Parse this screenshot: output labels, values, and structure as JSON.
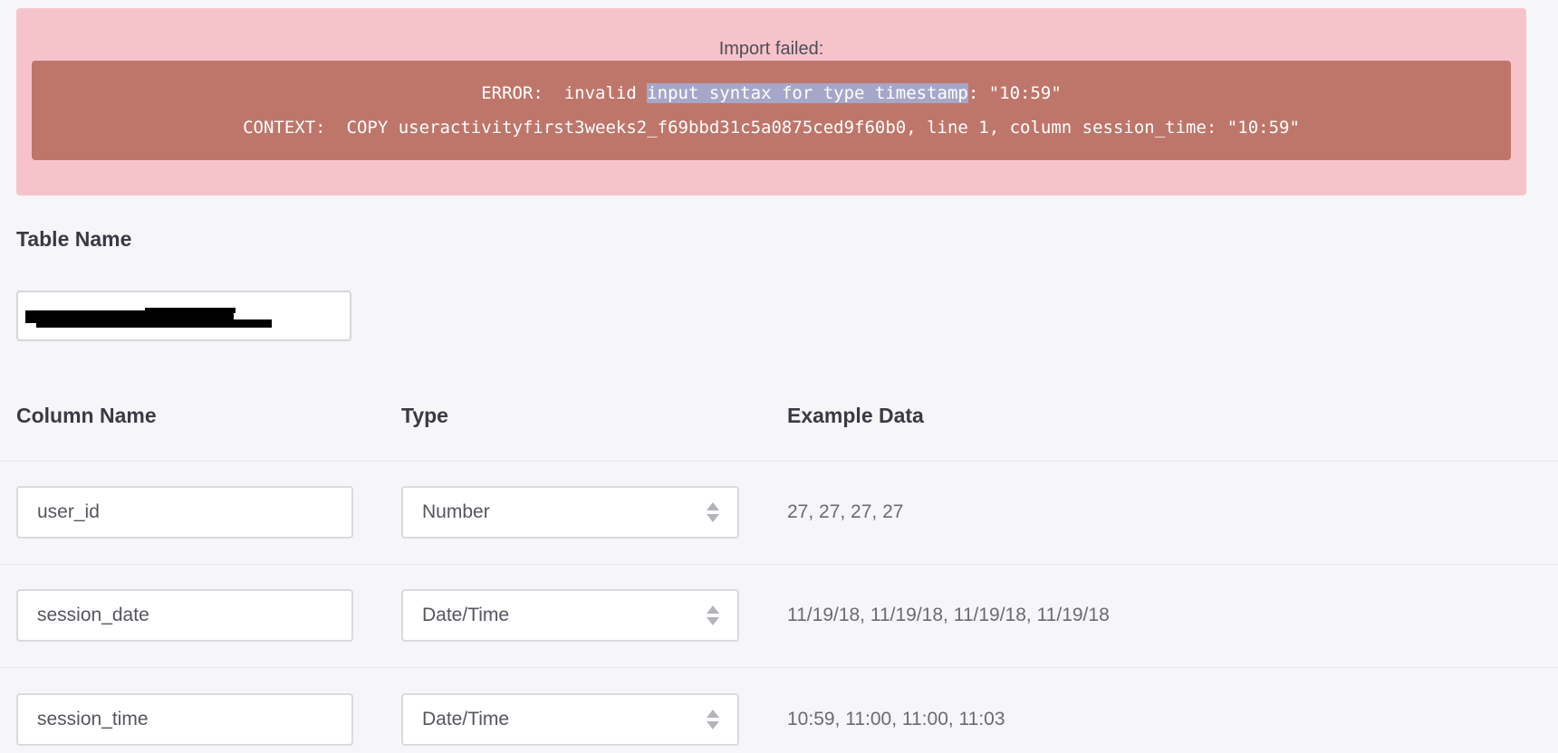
{
  "error": {
    "title": "Import failed:",
    "line1_prefix": "ERROR:  invalid ",
    "line1_highlight": "input syntax for type timestamp",
    "line1_suffix": ": \"10:59\"",
    "line2": "CONTEXT:  COPY useractivityfirst3weeks2_f69bbd31c5a0875ced9f60b0, line 1, column session_time: \"10:59\""
  },
  "table_name": {
    "label": "Table Name",
    "value": ""
  },
  "columns_header": {
    "name": "Column Name",
    "type": "Type",
    "example": "Example Data"
  },
  "rows": [
    {
      "name": "user_id",
      "type": "Number",
      "example": "27, 27, 27, 27"
    },
    {
      "name": "session_date",
      "type": "Date/Time",
      "example": "11/19/18, 11/19/18, 11/19/18, 11/19/18"
    },
    {
      "name": "session_time",
      "type": "Date/Time",
      "example": "10:59, 11:00, 11:00, 11:03"
    }
  ],
  "colors": {
    "error_banner_bg": "#f7c3cb",
    "error_box_bg": "#bf766a",
    "selection_highlight": "#a5a7c9",
    "page_bg": "#f6f6f9"
  }
}
